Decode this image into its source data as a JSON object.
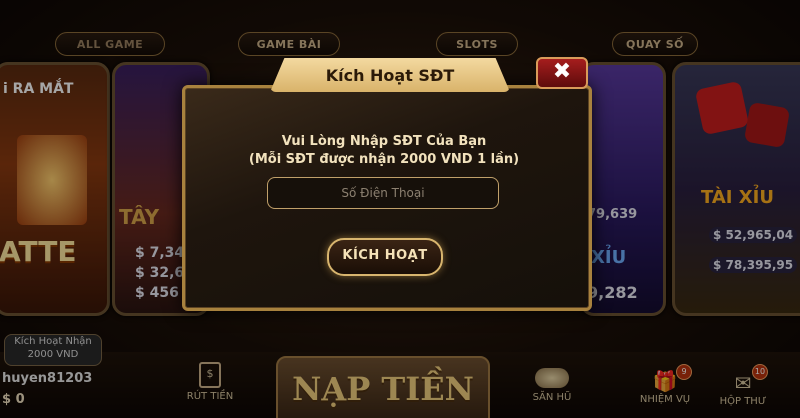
{
  "tabs": [
    "ALL GAME",
    "GAME BÀI",
    "SLOTS",
    "QUAY SỐ"
  ],
  "cards": {
    "left": {
      "banner": "i RA MẮT",
      "title": "ATTE"
    },
    "card2": {
      "title": "TÂY",
      "values": [
        "$ 7,34",
        "$ 32,6",
        "$ 456"
      ]
    },
    "card3": {
      "values": [
        "79,639",
        "9,282"
      ],
      "title": "XỈU"
    },
    "right": {
      "title": "TÀI XỈU",
      "values": [
        "$ 52,965,04",
        "$ 78,395,95"
      ]
    }
  },
  "modal": {
    "title": "Kích Hoạt SĐT",
    "close": "✖",
    "line1": "Vui Lòng Nhập SĐT Của Bạn",
    "line2": "(Mỗi SĐT được nhận 2000 VND 1 lần)",
    "phone_placeholder": "Số Điện Thoại",
    "activate": "KÍCH HOẠT"
  },
  "bottom": {
    "promo_line1": "Kích Hoạt Nhận",
    "promo_line2": "2000 VND",
    "username": "huyen81203",
    "balance": "$ 0",
    "withdraw": "RÚT TIỀN",
    "deposit": "NẠP TIỀN",
    "jackpot": "SĂN HŨ",
    "missions": "NHIỆM VỤ",
    "missions_badge": "9",
    "mail": "HỘP THƯ",
    "mail_badge": "10"
  },
  "colors": {
    "gold": "#d8b56e",
    "accent_red": "#a51d1d",
    "bg": "#1a0f08"
  }
}
